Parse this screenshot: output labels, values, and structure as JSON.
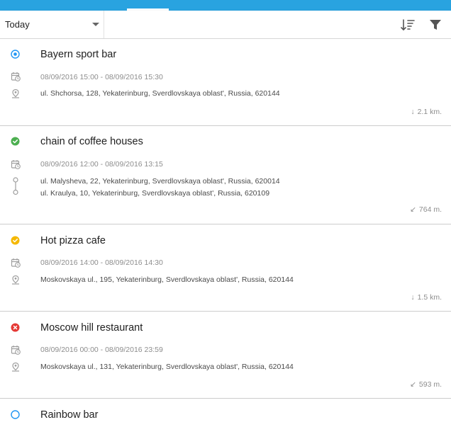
{
  "toolbar": {
    "period_label": "Today",
    "sort_icon": "sort-icon",
    "filter_icon": "filter-icon"
  },
  "colors": {
    "accent": "#29a3e0",
    "status_active": "#2196f3",
    "status_done": "#4caf50",
    "status_pending": "#f5b800",
    "status_failed": "#e53935"
  },
  "items": [
    {
      "title": "Bayern sport bar",
      "status": "active",
      "time": "08/09/2016 15:00 - 08/09/2016 15:30",
      "addresses": [
        "ul. Shchorsa, 128, Yekaterinburg, Sverdlovskaya oblast', Russia, 620144"
      ],
      "distance": "2.1 km.",
      "distance_arrow": "↓"
    },
    {
      "title": "chain of coffee houses",
      "status": "done",
      "time": "08/09/2016 12:00 - 08/09/2016 13:15",
      "addresses": [
        "ul. Malysheva, 22, Yekaterinburg, Sverdlovskaya oblast', Russia, 620014",
        "ul. Kraulya, 10, Yekaterinburg, Sverdlovskaya oblast', Russia, 620109"
      ],
      "distance": "764 m.",
      "distance_arrow": "↙"
    },
    {
      "title": "Hot pizza cafe",
      "status": "pending",
      "time": "08/09/2016 14:00 - 08/09/2016 14:30",
      "addresses": [
        "Moskovskaya ul., 195, Yekaterinburg, Sverdlovskaya oblast', Russia, 620144"
      ],
      "distance": "1.5 km.",
      "distance_arrow": "↓"
    },
    {
      "title": "Moscow hill restaurant",
      "status": "failed",
      "time": "08/09/2016 00:00 - 08/09/2016 23:59",
      "addresses": [
        "Moskovskaya ul., 131, Yekaterinburg, Sverdlovskaya oblast', Russia, 620144"
      ],
      "distance": "593 m.",
      "distance_arrow": "↙"
    },
    {
      "title": "Rainbow bar",
      "status": "open"
    }
  ]
}
